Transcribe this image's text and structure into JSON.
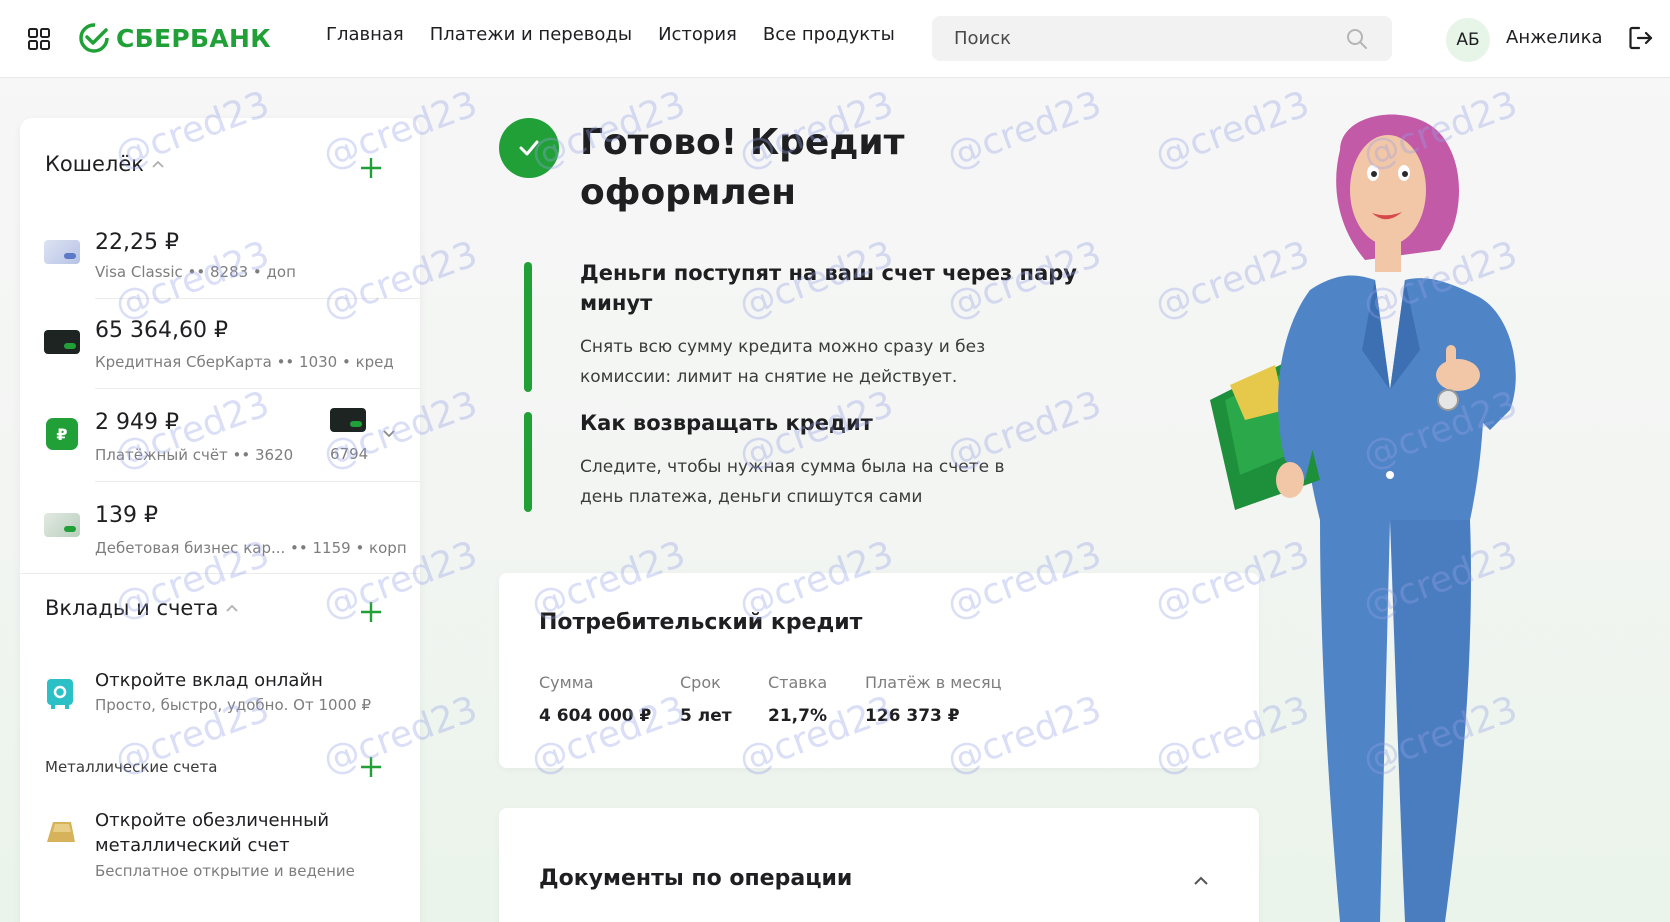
{
  "header": {
    "logo_text": "СБЕРБАНК",
    "nav": [
      "Главная",
      "Платежи и переводы",
      "История",
      "Все продукты"
    ],
    "search_placeholder": "Поиск",
    "avatar_initials": "АБ",
    "username": "Анжелика"
  },
  "sidebar": {
    "wallet_title": "Кошелёк",
    "accounts": [
      {
        "amount": "22,25 ₽",
        "details": "Visa Classic •• 8283 • доп"
      },
      {
        "amount": "65 364,60 ₽",
        "details": "Кредитная СберКарта •• 1030 • кред"
      },
      {
        "amount": "2 949 ₽",
        "details": "Платёжный счёт •• 3620",
        "linked_card": "6794"
      },
      {
        "amount": "139 ₽",
        "details": "Дебетовая бизнес кар... •• 1159 • корп"
      }
    ],
    "deposits_title": "Вклады и счета",
    "deposit_promo_title": "Откройте вклад онлайн",
    "deposit_promo_sub": "Просто, быстро, удобно. От 1000 ₽",
    "metal_label": "Металлические счета",
    "metal_promo_title": "Откройте обезличенный металлический счет",
    "metal_promo_sub": "Бесплатное открытие и ведение"
  },
  "main": {
    "title": "Готово! Кредит оформлен",
    "info": [
      {
        "heading": "Деньги поступят на ваш счет через пару минут",
        "text": "Снять всю сумму кредита можно сразу и без комиссии: лимит на снятие не действует."
      },
      {
        "heading": "Как возвращать кредит",
        "text": "Следите, чтобы нужная сумма была на счете в день платежа, деньги спишутся сами"
      }
    ],
    "loan": {
      "title": "Потребительский кредит",
      "amount_label": "Сумма",
      "amount": "4 604 000 ₽",
      "term_label": "Срок",
      "term": "5 лет",
      "rate_label": "Ставка",
      "rate": "21,7%",
      "payment_label": "Платёж в месяц",
      "payment": "126 373 ₽"
    },
    "docs_title": "Документы по операции"
  },
  "watermark": "@cred23",
  "colors": {
    "brand": "#21a038",
    "accent_bg": "#e6f5e8"
  }
}
